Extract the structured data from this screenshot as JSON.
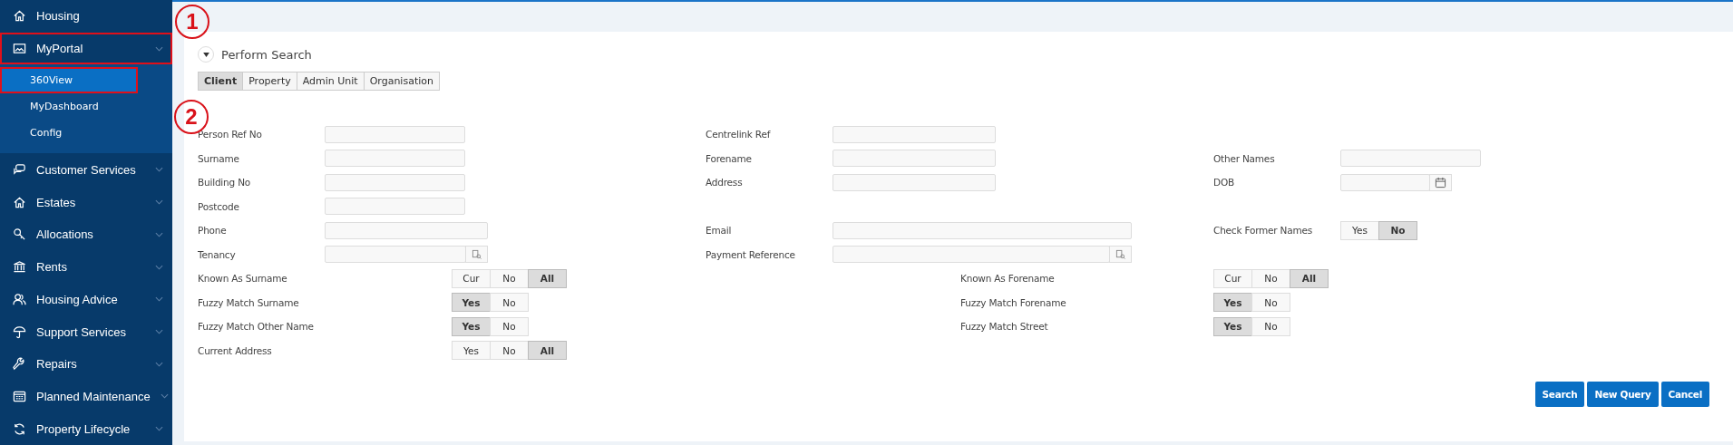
{
  "sidebar": {
    "items": [
      {
        "label": "Housing",
        "kind": "link",
        "highlighted": false
      },
      {
        "label": "MyPortal",
        "kind": "group",
        "expanded": true,
        "highlighted": true,
        "children": [
          {
            "label": "360View",
            "selected": true,
            "highlighted": true
          },
          {
            "label": "MyDashboard",
            "selected": false,
            "highlighted": false
          },
          {
            "label": "Config",
            "selected": false,
            "highlighted": false
          }
        ]
      },
      {
        "label": "Customer Services",
        "kind": "group",
        "highlighted": false
      },
      {
        "label": "Estates",
        "kind": "group",
        "highlighted": false
      },
      {
        "label": "Allocations",
        "kind": "group",
        "highlighted": false
      },
      {
        "label": "Rents",
        "kind": "group",
        "highlighted": false
      },
      {
        "label": "Housing Advice",
        "kind": "group",
        "highlighted": false
      },
      {
        "label": "Support Services",
        "kind": "group",
        "highlighted": false
      },
      {
        "label": "Repairs",
        "kind": "group",
        "highlighted": false
      },
      {
        "label": "Planned Maintenance",
        "kind": "group",
        "highlighted": false
      },
      {
        "label": "Property Lifecycle",
        "kind": "group",
        "highlighted": false
      }
    ]
  },
  "annotations": [
    {
      "label": "1"
    },
    {
      "label": "2"
    }
  ],
  "panel": {
    "title": "Perform Search",
    "expanded": true,
    "tabs": [
      {
        "label": "Client",
        "selected": true
      },
      {
        "label": "Property",
        "selected": false
      },
      {
        "label": "Admin Unit",
        "selected": false
      },
      {
        "label": "Organisation",
        "selected": false
      }
    ],
    "rows": [
      {
        "left": {
          "label": "Person Ref No",
          "kind": "text"
        },
        "middle": {
          "label": "Centrelink Ref",
          "kind": "text"
        }
      },
      {
        "left": {
          "label": "Surname",
          "kind": "text"
        },
        "middle": {
          "label": "Forename",
          "kind": "text"
        },
        "right": {
          "label": "Other Names",
          "kind": "text"
        }
      },
      {
        "left": {
          "label": "Building No",
          "kind": "text"
        },
        "middle": {
          "label": "Address",
          "kind": "text"
        },
        "right": {
          "label": "DOB",
          "kind": "date"
        }
      },
      {
        "left": {
          "label": "Postcode",
          "kind": "text"
        }
      },
      {
        "left": {
          "label": "Phone",
          "kind": "long"
        },
        "middle": {
          "label": "Email",
          "kind": "long"
        },
        "right": {
          "label": "Check Former Names",
          "kind": "toggle",
          "options": [
            {
              "label": "Yes",
              "selected": false
            },
            {
              "label": "No",
              "selected": true
            }
          ]
        }
      },
      {
        "left": {
          "label": "Tenancy",
          "kind": "lookup"
        },
        "middle": {
          "label": "Payment Reference",
          "kind": "lookup"
        }
      },
      {
        "left": {
          "label": "Known As Surname",
          "kind": "toggle",
          "options": [
            {
              "label": "Cur",
              "selected": false
            },
            {
              "label": "No",
              "selected": false
            },
            {
              "label": "All",
              "selected": true
            }
          ]
        },
        "right": {
          "label": "Known As Forename",
          "kind": "toggle",
          "options": [
            {
              "label": "Cur",
              "selected": false
            },
            {
              "label": "No",
              "selected": false
            },
            {
              "label": "All",
              "selected": true
            }
          ]
        }
      },
      {
        "left": {
          "label": "Fuzzy Match Surname",
          "kind": "toggle",
          "options": [
            {
              "label": "Yes",
              "selected": true
            },
            {
              "label": "No",
              "selected": false
            }
          ]
        },
        "right": {
          "label": "Fuzzy Match Forename",
          "kind": "toggle",
          "options": [
            {
              "label": "Yes",
              "selected": true
            },
            {
              "label": "No",
              "selected": false
            }
          ]
        }
      },
      {
        "left": {
          "label": "Fuzzy Match Other Name",
          "kind": "toggle",
          "options": [
            {
              "label": "Yes",
              "selected": true
            },
            {
              "label": "No",
              "selected": false
            }
          ]
        },
        "right": {
          "label": "Fuzzy Match Street",
          "kind": "toggle",
          "options": [
            {
              "label": "Yes",
              "selected": true
            },
            {
              "label": "No",
              "selected": false
            }
          ]
        }
      },
      {
        "left": {
          "label": "Current Address",
          "kind": "toggle",
          "options": [
            {
              "label": "Yes",
              "selected": false
            },
            {
              "label": "No",
              "selected": false
            },
            {
              "label": "All",
              "selected": true
            }
          ]
        }
      }
    ],
    "buttons": [
      "Search",
      "New Query",
      "Cancel"
    ]
  }
}
